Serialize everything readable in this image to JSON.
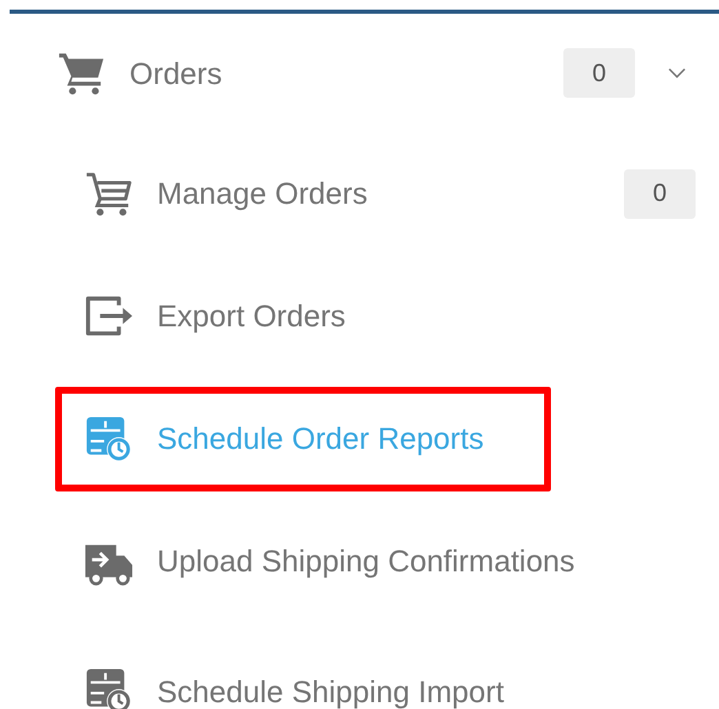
{
  "menu": {
    "label": "Orders",
    "count": "0",
    "expanded": true,
    "kind": "cart",
    "items": [
      {
        "label": "Manage Orders",
        "kind": "cart-outline",
        "count": "0",
        "selected": false,
        "highlighted": false
      },
      {
        "label": "Export Orders",
        "kind": "export",
        "selected": false,
        "highlighted": false
      },
      {
        "label": "Schedule Order Reports",
        "kind": "schedule",
        "selected": true,
        "highlighted": true
      },
      {
        "label": "Upload Shipping Confirmations",
        "kind": "truck",
        "selected": false,
        "highlighted": false
      },
      {
        "label": "Schedule Shipping Import",
        "kind": "schedule",
        "selected": false,
        "highlighted": false
      }
    ]
  }
}
